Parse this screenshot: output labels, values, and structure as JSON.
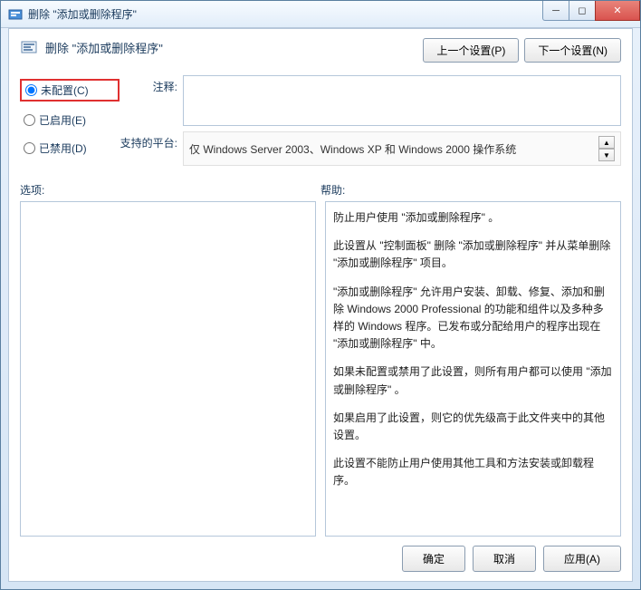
{
  "titlebar": {
    "title": "删除 \"添加或删除程序\""
  },
  "header": {
    "title": "删除 \"添加或删除程序\"",
    "prev_setting": "上一个设置(P)",
    "next_setting": "下一个设置(N)"
  },
  "radios": {
    "not_configured": "未配置(C)",
    "enabled": "已启用(E)",
    "disabled": "已禁用(D)"
  },
  "fields": {
    "comment_label": "注释:",
    "comment_value": "",
    "platform_label": "支持的平台:",
    "platform_value": "仅 Windows Server 2003、Windows XP 和 Windows 2000 操作系统"
  },
  "section_labels": {
    "options": "选项:",
    "help": "帮助:"
  },
  "help_paragraphs": [
    "防止用户使用 \"添加或删除程序\" 。",
    "此设置从 \"控制面板\" 删除 \"添加或删除程序\" 并从菜单删除 \"添加或删除程序\" 项目。",
    "\"添加或删除程序\" 允许用户安装、卸载、修复、添加和删除 Windows 2000 Professional 的功能和组件以及多种多样的 Windows 程序。已发布或分配给用户的程序出现在 \"添加或删除程序\" 中。",
    "如果未配置或禁用了此设置，则所有用户都可以使用 \"添加或删除程序\" 。",
    "如果启用了此设置，则它的优先级高于此文件夹中的其他设置。",
    "此设置不能防止用户使用其他工具和方法安装或卸载程序。"
  ],
  "footer": {
    "ok": "确定",
    "cancel": "取消",
    "apply": "应用(A)"
  }
}
